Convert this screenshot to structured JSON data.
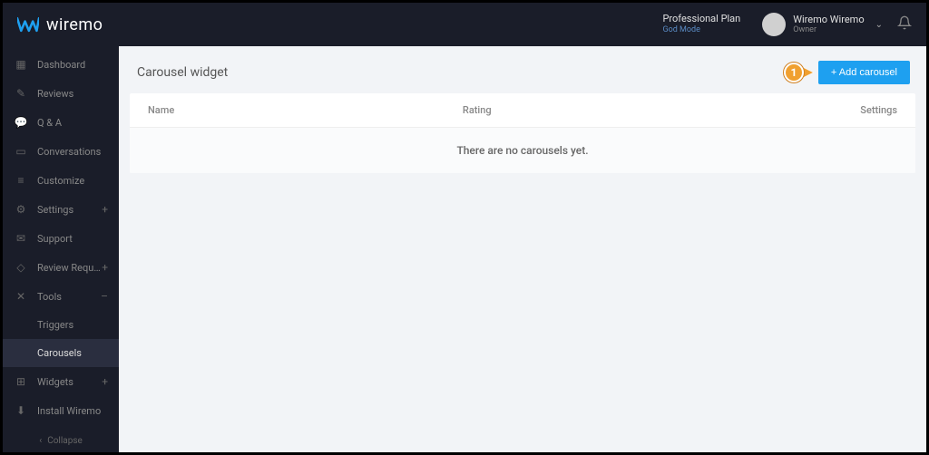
{
  "brand": {
    "name": "wiremo"
  },
  "topbar": {
    "plan_label": "Professional Plan",
    "plan_mode": "God Mode",
    "user_name": "Wiremo Wiremo",
    "user_role": "Owner"
  },
  "sidebar": {
    "items": [
      {
        "icon": "dashboard",
        "label": "Dashboard",
        "expand": ""
      },
      {
        "icon": "reviews",
        "label": "Reviews",
        "expand": ""
      },
      {
        "icon": "qa",
        "label": "Q & A",
        "expand": ""
      },
      {
        "icon": "conversations",
        "label": "Conversations",
        "expand": ""
      },
      {
        "icon": "customize",
        "label": "Customize",
        "expand": ""
      },
      {
        "icon": "settings",
        "label": "Settings",
        "expand": "+"
      },
      {
        "icon": "support",
        "label": "Support",
        "expand": ""
      },
      {
        "icon": "review-request",
        "label": "Review Request",
        "expand": "+"
      },
      {
        "icon": "tools",
        "label": "Tools",
        "expand": "–"
      },
      {
        "icon": "widgets",
        "label": "Widgets",
        "expand": "+"
      },
      {
        "icon": "install",
        "label": "Install Wiremo",
        "expand": ""
      }
    ],
    "sub_triggers": "Triggers",
    "sub_carousels": "Carousels",
    "collapse_label": "Collapse"
  },
  "page": {
    "title": "Carousel widget",
    "add_button": "+ Add carousel",
    "callout_number": "1",
    "columns": {
      "name": "Name",
      "rating": "Rating",
      "settings": "Settings"
    },
    "empty_message": "There are no carousels yet."
  }
}
